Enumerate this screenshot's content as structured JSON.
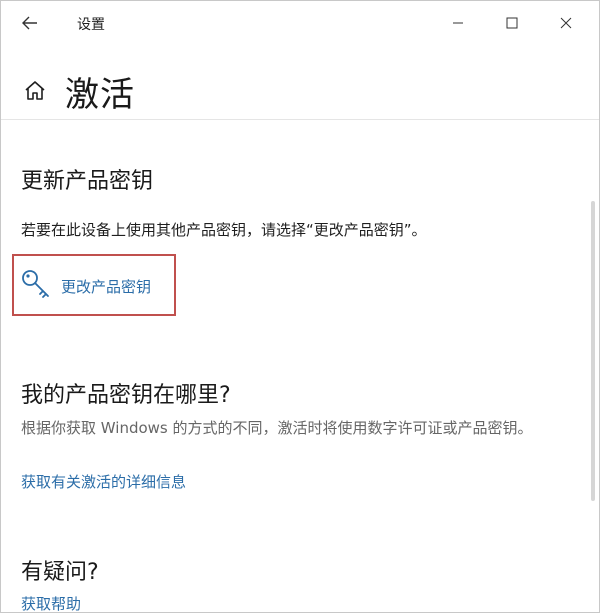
{
  "window": {
    "title": "设置",
    "controls": {
      "back": "←",
      "minimize": "—",
      "maximize": "☐",
      "close": "✕"
    }
  },
  "header": {
    "title": "激活"
  },
  "update_key": {
    "title": "更新产品密钥",
    "description": "若要在此设备上使用其他产品密钥，请选择“更改产品密钥”。",
    "button_label": "更改产品密钥"
  },
  "where_key": {
    "title": "我的产品密钥在哪里?",
    "description": "根据你获取 Windows 的方式的不同，激活时将使用数字许可证或产品密钥。",
    "link": "获取有关激活的详细信息"
  },
  "questions": {
    "title": "有疑问?",
    "link": "获取帮助"
  },
  "colors": {
    "accent": "#2b6da8",
    "highlight_box": "#c0504d"
  }
}
